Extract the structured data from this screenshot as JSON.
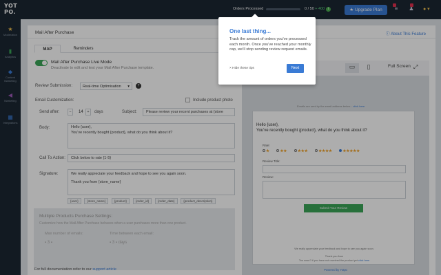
{
  "topbar": {
    "logo_line1": "YOT",
    "logo_line2": "PO.",
    "orders_label": "Orders Processed",
    "orders_count": "0 / 50",
    "orders_plus": "+ 400",
    "orders_progress_percent": 0,
    "upgrade_label": "Upgrade Plan",
    "user_icon": "user-icon"
  },
  "sidebar": {
    "items": [
      {
        "label": "Moderation",
        "icon": "star-icon"
      },
      {
        "label": "Analytics",
        "icon": "chart-icon"
      },
      {
        "label": "Content Marketing",
        "icon": "megaphone-icon"
      },
      {
        "label": "Marketing",
        "icon": "speaker-icon"
      },
      {
        "label": "Integrations",
        "icon": "grid-icon"
      }
    ]
  },
  "page": {
    "title": "Mail After Purchase",
    "about_link": "About This Feature"
  },
  "tabs": [
    {
      "label": "MAP"
    },
    {
      "label": "Reminders"
    }
  ],
  "live_mode": {
    "title": "Mail After Purchase Live Mode",
    "subtitle": "Deactivate to edit and test your Mail After Purchase template."
  },
  "form": {
    "review_submission_label": "Review Submission:",
    "review_submission_value": "Real-time Optimisation",
    "email_customization_label": "Email Customization:",
    "include_photo_label": "Include product photo",
    "send_after_label": "Send after:",
    "send_after_value": "14",
    "send_after_unit": "days",
    "subject_label": "Subject:",
    "subject_value": "Please review your recent purchases at {store",
    "body_label": "Body:",
    "body_line1": "Hello {user},",
    "body_line2": "You've recently bought {product}, what do you think about it?",
    "cta_label": "Call To Action:",
    "cta_value": "Click below to rate {1-5}",
    "signature_label": "Signature:",
    "signature_line1": "We really appreciate your feedback and hope to see you again soon.",
    "signature_line2": "Thank you from {store_name}",
    "tags": [
      "{user}",
      "{store_name}",
      "{product}",
      "{order_id}",
      "{order_date}",
      "{product_description}"
    ]
  },
  "multi": {
    "title": "Multiple Products Purchase Settings:",
    "description": "Customize how the Mail After Purchase behaves when a user purchases more than one product.",
    "max_emails_label": "Max number of emails:",
    "max_emails_value": "3",
    "time_between_label": "Time between each email:",
    "time_between_value": "3",
    "time_between_unit": "days"
  },
  "documentation": {
    "text": "For full documentation refer to our",
    "link": "support article"
  },
  "preview": {
    "full_screen_label": "Full Screen",
    "notice": "Emails are sent by the email address below...",
    "notice_link": "click here",
    "greeting": "Hello {user},",
    "question": "You've recently bought {product}, what do you think about it?",
    "rate_label": "Rate:",
    "ratings": [
      "★",
      "★★",
      "★★★",
      "★★★★",
      "★★★★★"
    ],
    "selected_rating": 5,
    "review_title_label": "Review Title:",
    "review_label": "Review:",
    "submit_label": "Submit Your Review",
    "footer_line1": "We really appreciate your feedback and hope to see you again soon.",
    "footer_line2": "Thank you from",
    "footer_line3": "Too soon? If you have not received the product yet",
    "footer_link": "click here",
    "powered_by": "Powered by Yotpo"
  },
  "tooltip": {
    "title": "One last thing...",
    "body": "Track the amount of orders you've processed each month. Once you've reached your monthly cap, we'll stop sending review request emails.",
    "hide_label": "Hide these tips",
    "next_label": "Next"
  },
  "colors": {
    "accent": "#3a7bd5",
    "success": "#3aa657",
    "dark": "#1b2733"
  }
}
